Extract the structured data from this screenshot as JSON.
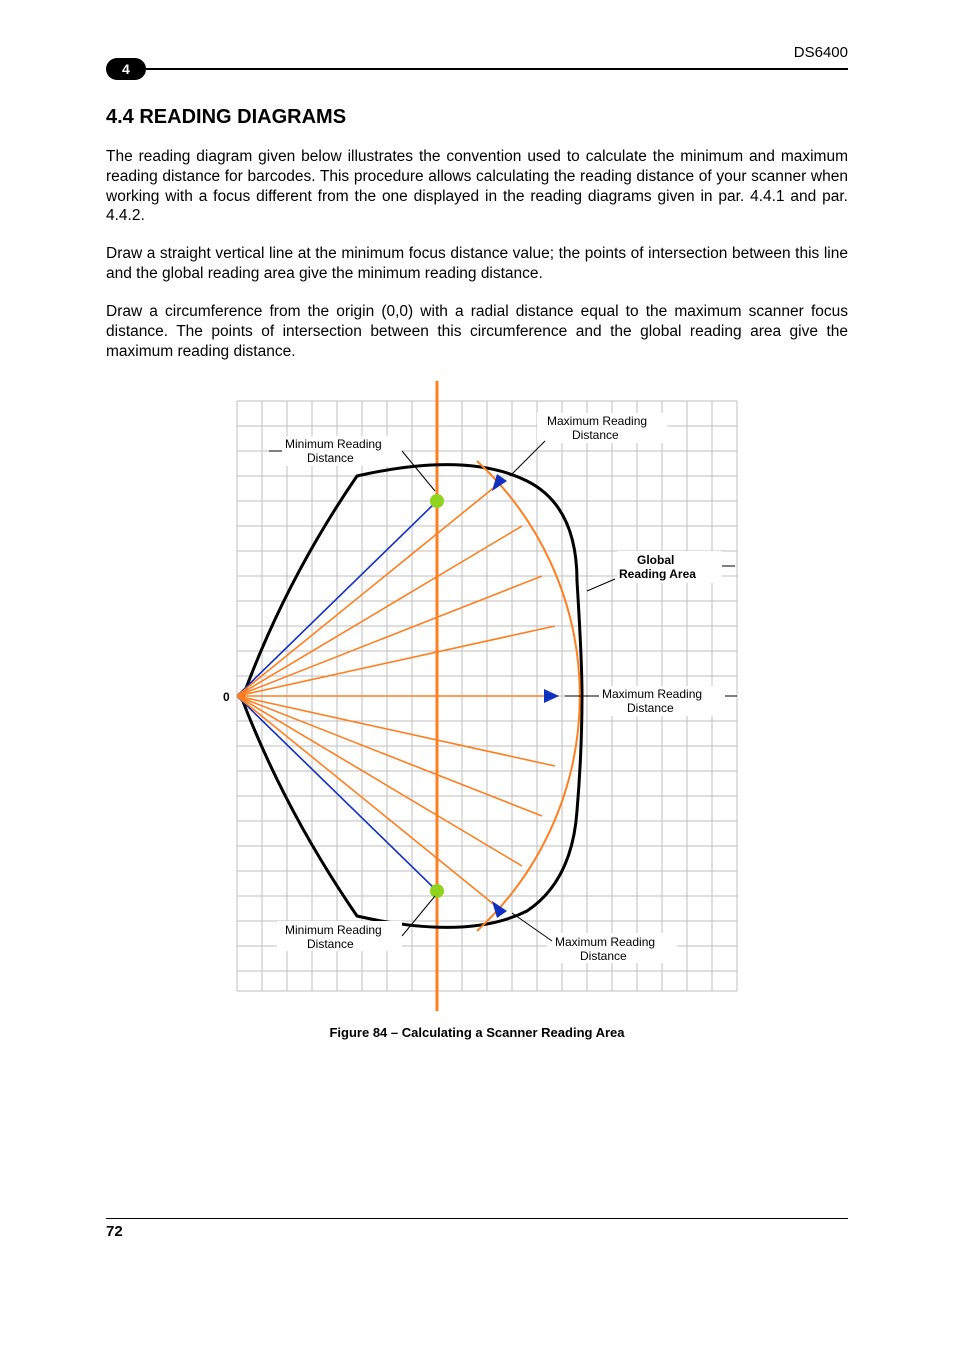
{
  "doc_id": "DS6400",
  "chapter_badge": "4",
  "section_number_title": "4.4  READING DIAGRAMS",
  "para1": "The reading diagram given below illustrates the convention used to calculate the minimum and maximum reading distance for barcodes. This procedure allows calculating the reading distance of your scanner when working with a focus different from the one displayed in the reading diagrams given in par. 4.4.1 and par. 4.4.2.",
  "para2": "Draw a straight vertical line at the minimum focus distance value; the points of intersection between this line and the global reading area give the minimum reading distance.",
  "para3": "Draw a circumference from the origin (0,0) with a radial distance equal to the maximum scanner focus distance. The points of intersection between this circumference and the global reading area give the maximum reading distance.",
  "figure_caption": "Figure 84 – Calculating a Scanner Reading Area",
  "page_number": "72",
  "diagram": {
    "origin_label": "0",
    "min_reading_top": "Minimum Reading",
    "min_reading_bottom": "Distance",
    "max_reading_top": "Maximum Reading",
    "max_reading_bottom": "Distance",
    "global_top": "Global",
    "global_bottom": "Reading Area"
  }
}
